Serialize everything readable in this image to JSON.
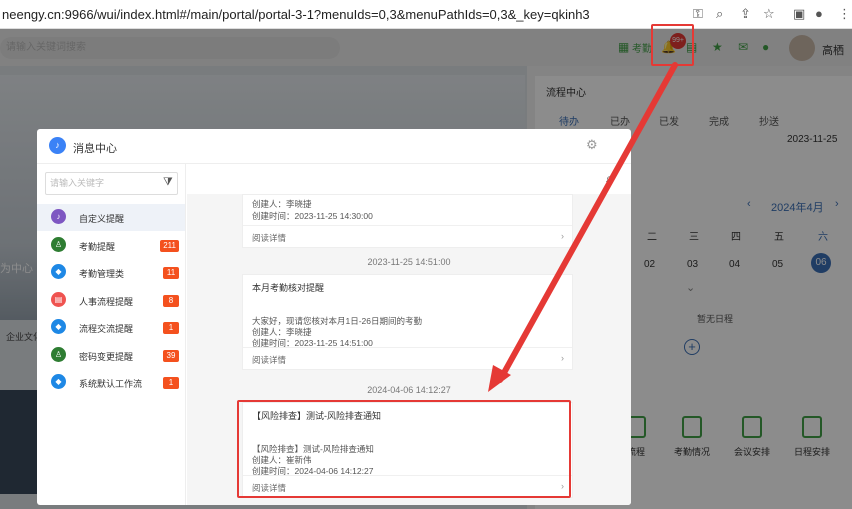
{
  "browser": {
    "url": "neengy.cn:9966/wui/index.html#/main/portal/portal-3-1?menuIds=0,3&menuPathIds=0,3&_key=qkinh3"
  },
  "topbar": {
    "search_placeholder": "请输入关键词搜索",
    "attendance_label": "考勤",
    "bell_badge": "99+",
    "user_name": "高栖"
  },
  "left_bg": {
    "hero_text": "为中心",
    "corp_text": "企业文化"
  },
  "workflow": {
    "title": "流程中心",
    "tabs": [
      "待办",
      "已办",
      "已发",
      "完成",
      "抄送"
    ],
    "item_date": "2023-11-25"
  },
  "calendar": {
    "month": "2024年4月",
    "weekdays": [
      "二",
      "三",
      "四",
      "五",
      "六"
    ],
    "days": [
      "02",
      "03",
      "04",
      "05",
      "06"
    ],
    "empty_text": "暂无日程"
  },
  "quick_actions": [
    "流程",
    "考勤情况",
    "会议安排",
    "日程安排"
  ],
  "modal": {
    "title": "消息中心",
    "search_placeholder": "请输入关键字",
    "categories": [
      {
        "label": "自定义提醒",
        "badge": "",
        "color": "#7e57c2",
        "icon": "bell-icon"
      },
      {
        "label": "考勤提醒",
        "badge": "211",
        "color": "#2e7d32",
        "icon": "person-icon"
      },
      {
        "label": "考勤管理类",
        "badge": "11",
        "color": "#1e88e5",
        "icon": "diamond-icon"
      },
      {
        "label": "人事流程提醒",
        "badge": "8",
        "color": "#ef5350",
        "icon": "document-icon"
      },
      {
        "label": "流程交流提醒",
        "badge": "1",
        "color": "#1e88e5",
        "icon": "diamond-icon"
      },
      {
        "label": "密码变更提醒",
        "badge": "39",
        "color": "#2e7d32",
        "icon": "person-icon"
      },
      {
        "label": "系统默认工作流",
        "badge": "1",
        "color": "#1e88e5",
        "icon": "diamond-icon"
      }
    ],
    "messages": [
      {
        "title": "",
        "lines": [
          "创建人：李晓捷",
          "创建时间：2023-11-25 14:30:00"
        ],
        "footer": "阅读详情"
      },
      {
        "timestamp": "2023-11-25 14:51:00",
        "title": "本月考勤核对提醒",
        "lines": [
          "大家好，现请您核对本月1日-26日期间的考勤",
          "创建人：李晓捷",
          "创建时间：2023-11-25 14:51:00"
        ],
        "footer": "阅读详情"
      },
      {
        "timestamp": "2024-04-06 14:12:27",
        "title": "【风险排查】测试-风险排查通知",
        "lines": [
          "【风险排查】测试-风险排查通知",
          "创建人：崔新伟",
          "创建时间：2024-04-06 14:12:27"
        ],
        "footer": "阅读详情"
      }
    ]
  },
  "colors": {
    "accent": "#3b6fb6",
    "highlight": "#e53935",
    "badge": "#f4511e"
  }
}
